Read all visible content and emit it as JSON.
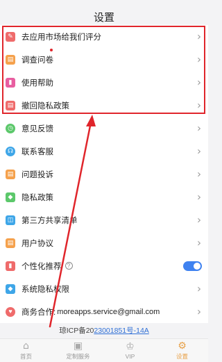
{
  "header": {
    "title": "设置"
  },
  "settings": {
    "items": [
      {
        "label": "去应用市场给我们评分",
        "icon": "edit-icon",
        "color": "#ef6b6b"
      },
      {
        "label": "调查问卷",
        "icon": "document-icon",
        "color": "#f5a14c"
      },
      {
        "label": "使用帮助",
        "icon": "bookmark-icon",
        "color": "#e85ea0"
      },
      {
        "label": "撤回隐私政策",
        "icon": "document-icon",
        "color": "#ef6b6b"
      },
      {
        "label": "意见反馈",
        "icon": "clock-icon",
        "color": "#5cc86b"
      },
      {
        "label": "联系客服",
        "icon": "headset-icon",
        "color": "#3ea6e8"
      },
      {
        "label": "问题投诉",
        "icon": "document-icon",
        "color": "#f5a14c"
      },
      {
        "label": "隐私政策",
        "icon": "shield-icon",
        "color": "#5cc86b"
      },
      {
        "label": "第三方共享清单",
        "icon": "box-icon",
        "color": "#3ea6e8"
      },
      {
        "label": "用户协议",
        "icon": "document-icon",
        "color": "#f5a14c"
      },
      {
        "label": "个性化推荐",
        "icon": "bookmark-icon",
        "color": "#ef6b6b",
        "toggle": true
      },
      {
        "label": "系统隐私权限",
        "icon": "shield-icon",
        "color": "#3ea6e8"
      },
      {
        "label": "商务合作:",
        "icon": "heart-icon",
        "color": "#ef6b6b",
        "email": "moreapps.service@gmail.com"
      }
    ],
    "help_glyph": "?"
  },
  "footer": {
    "icp_prefix": "琼ICP备20",
    "icp_link": "23001851号-14A"
  },
  "tabbar": {
    "tabs": [
      {
        "label": "首页",
        "icon": "home-icon"
      },
      {
        "label": "定制服务",
        "icon": "bag-icon"
      },
      {
        "label": "VIP",
        "icon": "crown-icon"
      },
      {
        "label": "设置",
        "icon": "gear-icon",
        "active": true
      }
    ]
  },
  "annotation": {
    "color": "#e0252b"
  },
  "personalized_recommendation_enabled": true
}
